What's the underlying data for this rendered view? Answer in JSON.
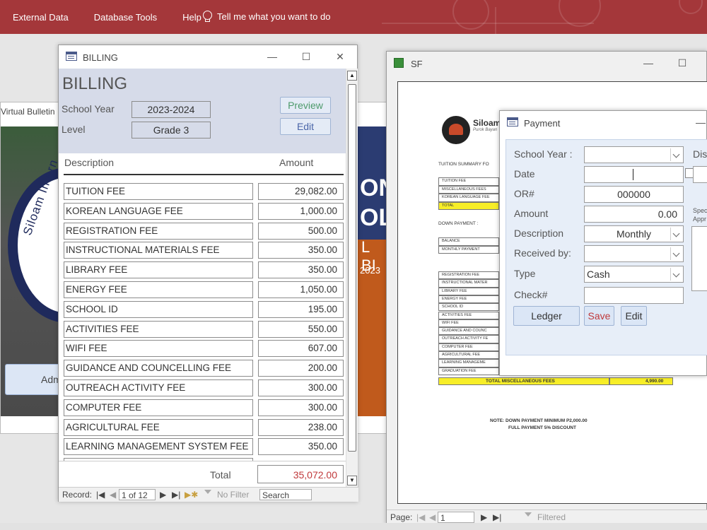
{
  "ribbon": {
    "items": [
      "External Data",
      "Database Tools",
      "Help"
    ],
    "tell_me": "Tell me what you want to do"
  },
  "bulletin": {
    "title": "Virtual Bulletin",
    "seal_text": "Siloam Intern",
    "poster_lines": [
      "ONA",
      "OL"
    ],
    "poster_bi": "L BI",
    "poster_year": "2023",
    "button_label": "Adm"
  },
  "billing": {
    "window_title": "BILLING",
    "form_title": "BILLING",
    "school_year_label": "School Year",
    "school_year_value": "2023-2024",
    "level_label": "Level",
    "level_value": "Grade 3",
    "preview_label": "Preview",
    "edit_label": "Edit",
    "col_description": "Description",
    "col_amount": "Amount",
    "rows": [
      {
        "description": "TUITION FEE",
        "amount": "29,082.00"
      },
      {
        "description": "KOREAN LANGUAGE FEE",
        "amount": "1,000.00"
      },
      {
        "description": "REGISTRATION FEE",
        "amount": "500.00"
      },
      {
        "description": "INSTRUCTIONAL MATERIALS FEE",
        "amount": "350.00"
      },
      {
        "description": "LIBRARY FEE",
        "amount": "350.00"
      },
      {
        "description": "ENERGY FEE",
        "amount": "1,050.00"
      },
      {
        "description": "SCHOOL ID",
        "amount": "195.00"
      },
      {
        "description": "ACTIVITIES FEE",
        "amount": "550.00"
      },
      {
        "description": "WIFI FEE",
        "amount": "607.00"
      },
      {
        "description": "GUIDANCE AND COUNCELLING FEE",
        "amount": "200.00"
      },
      {
        "description": "OUTREACH ACTIVITY FEE",
        "amount": "300.00"
      },
      {
        "description": "COMPUTER FEE",
        "amount": "300.00"
      },
      {
        "description": "AGRICULTURAL FEE",
        "amount": "238.00"
      },
      {
        "description": "LEARNING MANAGEMENT SYSTEM FEE",
        "amount": "350.00"
      }
    ],
    "total_label": "Total",
    "total_value": "35,072.00",
    "nav": {
      "record_label": "Record:",
      "position": "1 of 12",
      "filter": "No Filter",
      "search": "Search"
    }
  },
  "sf": {
    "window_title": "SF",
    "brand": "Siloam",
    "brand_sub": "Purok Bayan",
    "tuition_summary": "TUITION SUMMARY FO",
    "summary_rows": [
      "TUITION FEE",
      "MISCELLANEOUS FEES",
      "KOREAN LANGUAGE FEE",
      "TOTAL"
    ],
    "down_payment": "DOWN PAYMENT :",
    "balance_rows": [
      "BALANCE",
      "MONTHLY PAYMENT"
    ],
    "misc_rows": [
      "REGISTRATION FEE",
      "INSTRUCTIONAL MATER",
      "LIBRARY FEE",
      "ENERGY FEE",
      "SCHOOL ID",
      "ACTIVITIES FEE",
      "WIFI FEE",
      "GUIDANCE AND COUNC",
      "OUTREACH ACTIVITY FE",
      "COMPUTER FEE",
      "AGRICULTURAL FEE",
      "LEARNING MANAGEME",
      "GRADUATION FEE"
    ],
    "total_misc_label": "TOTAL MISCELLANEOUS FEES",
    "total_misc_value": "4,990.00",
    "note1": "NOTE: DOWN PAYMENT MINIMUM P2,000.00",
    "note2": "FULL PAYMENT 5% DISCOUNT",
    "page_label": "Page:",
    "page_value": "1",
    "filtered": "Filtered"
  },
  "payment": {
    "window_title": "Payment",
    "school_year_label": "School Year :",
    "school_year_value": "",
    "date_label": "Date",
    "date_value": "",
    "or_label": "OR#",
    "or_value": "000000",
    "amount_label": "Amount",
    "amount_value": "0.00",
    "description_label": "Description",
    "description_value": "Monthly",
    "received_label": "Received by:",
    "received_value": "",
    "type_label": "Type",
    "type_value": "Cash",
    "check_label": "Check#",
    "check_value": "",
    "discount_label": "Disc",
    "special_label_1": "Spec",
    "special_label_2": "Appr",
    "ledger_label": "Ledger",
    "save_label": "Save",
    "edit_label": "Edit"
  }
}
